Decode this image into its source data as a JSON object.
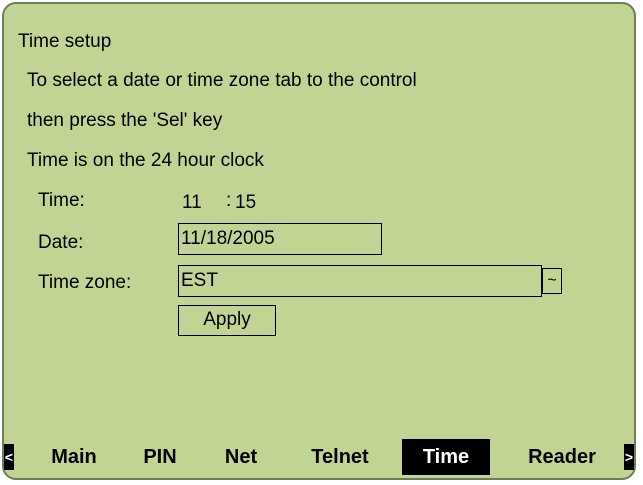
{
  "title": "Time setup",
  "instructions": [
    "To select a date or time zone tab to the control",
    "then press the 'Sel' key",
    "Time is on the 24 hour clock"
  ],
  "form": {
    "time_label": "Time:",
    "time_hours": "11",
    "time_separator": ":",
    "time_minutes": "15",
    "date_label": "Date:",
    "date_value": "11/18/2005",
    "timezone_label": "Time zone:",
    "timezone_value": "EST",
    "dropdown_glyph": "~",
    "apply_label": "Apply"
  },
  "tabs": {
    "left_arrow": "<",
    "right_arrow": ">",
    "items": [
      "Main",
      "PIN",
      "Net",
      "Telnet",
      "Time",
      "Reader"
    ],
    "active": "Time"
  },
  "colors": {
    "screen_background": "#c2d493",
    "screen_border": "#6e7e56",
    "active_tab_background": "#000000",
    "active_tab_text": "#ffffff"
  }
}
